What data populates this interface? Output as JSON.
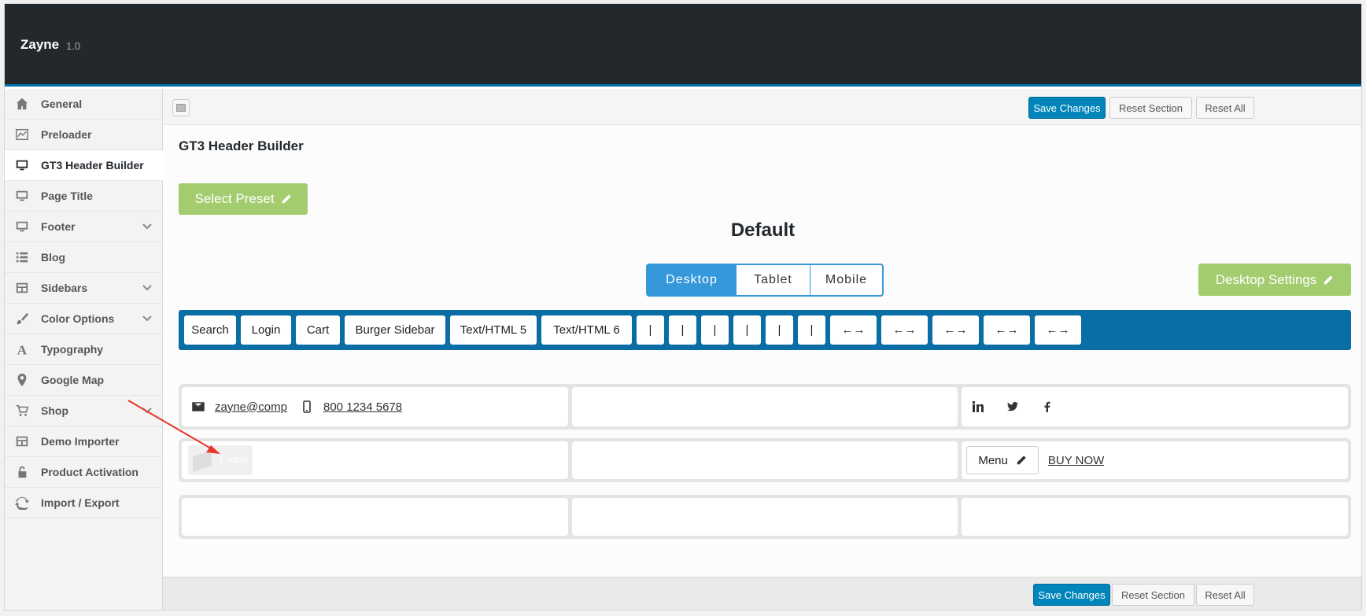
{
  "app": {
    "title": "Zayne",
    "version": "1.0"
  },
  "sidebar": {
    "items": [
      {
        "label": "General",
        "icon": "home-icon",
        "active": false,
        "chevron": false
      },
      {
        "label": "Preloader",
        "icon": "chart-icon",
        "active": false,
        "chevron": false
      },
      {
        "label": "GT3 Header Builder",
        "icon": "desktop-icon",
        "active": true,
        "chevron": false
      },
      {
        "label": "Page Title",
        "icon": "desktop-icon",
        "active": false,
        "chevron": false
      },
      {
        "label": "Footer",
        "icon": "desktop-icon",
        "active": false,
        "chevron": true
      },
      {
        "label": "Blog",
        "icon": "list-icon",
        "active": false,
        "chevron": false
      },
      {
        "label": "Sidebars",
        "icon": "layout-icon",
        "active": false,
        "chevron": true
      },
      {
        "label": "Color Options",
        "icon": "brush-icon",
        "active": false,
        "chevron": true
      },
      {
        "label": "Typography",
        "icon": "typography-icon",
        "active": false,
        "chevron": false
      },
      {
        "label": "Google Map",
        "icon": "map-pin-icon",
        "active": false,
        "chevron": false
      },
      {
        "label": "Shop",
        "icon": "cart-icon",
        "active": false,
        "chevron": true
      },
      {
        "label": "Demo Importer",
        "icon": "layout-icon",
        "active": false,
        "chevron": false
      },
      {
        "label": "Product Activation",
        "icon": "unlock-icon",
        "active": false,
        "chevron": false
      },
      {
        "label": "Import / Export",
        "icon": "refresh-icon",
        "active": false,
        "chevron": false
      }
    ]
  },
  "toolbar": {
    "save_label": "Save Changes",
    "reset_section_label": "Reset Section",
    "reset_all_label": "Reset All"
  },
  "main": {
    "section_title": "GT3 Header Builder",
    "preset_label": "Select Preset",
    "preset_name": "Default",
    "device_tabs": [
      "Desktop",
      "Tablet",
      "Mobile"
    ],
    "active_device": "Desktop",
    "settings_label": "Desktop Settings",
    "elements": [
      "Search",
      "Login",
      "Cart",
      "Burger Sidebar",
      "Text/HTML 5",
      "Text/HTML 6",
      "|",
      "|",
      "|",
      "|",
      "|",
      "|",
      "←→",
      "←→",
      "←→",
      "←→",
      "←→"
    ],
    "rows": {
      "top_email": "zayne@company.com",
      "top_phone": "800 1234 5678",
      "logo_text": "Consu",
      "menu_label": "Menu",
      "buy_label": "BUY NOW"
    }
  },
  "footer_toolbar": {
    "save_label": "Save Changes",
    "reset_section_label": "Reset Section",
    "reset_all_label": "Reset All"
  },
  "colors": {
    "topbar": "#23282d",
    "accent": "#0073aa",
    "green": "#a3cc6e",
    "device_blue": "#3498db",
    "elements_bar": "#0a6ea6",
    "arrow": "#e8352a"
  }
}
